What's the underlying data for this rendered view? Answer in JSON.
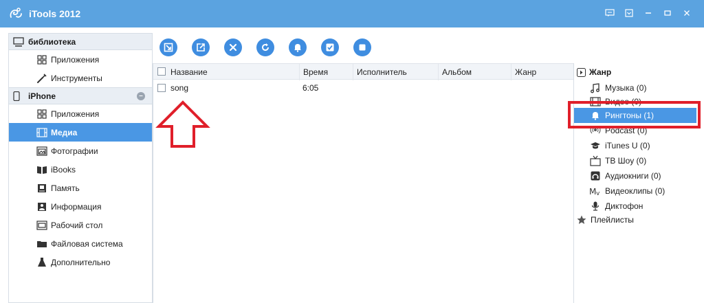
{
  "app": {
    "title": "iTools 2012"
  },
  "window_controls": [
    "feedback-icon",
    "dropdown-icon",
    "minimize-icon",
    "maximize-icon",
    "close-icon"
  ],
  "sidebar": {
    "library": {
      "label": "библиотека",
      "items": [
        {
          "label": "Приложения",
          "icon": "apps-grid-icon"
        },
        {
          "label": "Инструменты",
          "icon": "wrench-icon"
        }
      ]
    },
    "device": {
      "label": "iPhone",
      "items": [
        {
          "label": "Приложения",
          "icon": "apps-grid-icon",
          "active": false
        },
        {
          "label": "Медиа",
          "icon": "film-icon",
          "active": true
        },
        {
          "label": "Фотографии",
          "icon": "photo-icon",
          "active": false
        },
        {
          "label": "iBooks",
          "icon": "book-icon",
          "active": false
        },
        {
          "label": "Память",
          "icon": "memory-icon",
          "active": false
        },
        {
          "label": "Информация",
          "icon": "info-icon",
          "active": false
        },
        {
          "label": "Рабочий стол",
          "icon": "desktop-icon",
          "active": false
        },
        {
          "label": "Файловая система",
          "icon": "folder-icon",
          "active": false
        },
        {
          "label": "Дополнительно",
          "icon": "flask-icon",
          "active": false
        }
      ]
    }
  },
  "toolbar": {
    "buttons": [
      "import-icon",
      "export-icon",
      "delete-icon",
      "refresh-icon",
      "ringtone-icon",
      "check-icon",
      "stop-icon"
    ]
  },
  "table": {
    "columns": [
      "Название",
      "Время",
      "Исполнитель",
      "Альбом",
      "Жанр"
    ],
    "rows": [
      {
        "name": "song",
        "time": "6:05",
        "artist": "",
        "album": "",
        "genre": ""
      }
    ]
  },
  "right_panel": {
    "header": "Жанр",
    "items": [
      {
        "label": "Музыка (0)",
        "icon": "music-note-icon"
      },
      {
        "label": "Видео (0)",
        "icon": "video-icon"
      },
      {
        "label": "Рингтоны (1)",
        "icon": "bell-icon",
        "selected": true
      },
      {
        "label": "Podcast (0)",
        "icon": "podcast-icon"
      },
      {
        "label": "iTunes U (0)",
        "icon": "graduation-cap-icon"
      },
      {
        "label": "ТВ Шоу (0)",
        "icon": "tv-icon"
      },
      {
        "label": "Аудиокниги (0)",
        "icon": "audiobook-icon"
      },
      {
        "label": "Видеоклипы (0)",
        "icon": "music-video-icon"
      },
      {
        "label": "Диктофон",
        "icon": "microphone-icon"
      }
    ],
    "footer": "Плейлисты"
  },
  "colors": {
    "titlebar": "#5ba3e0",
    "accent": "#4a97e4",
    "toolbar_button": "#3f8de0",
    "annotation": "#e01f2a"
  }
}
